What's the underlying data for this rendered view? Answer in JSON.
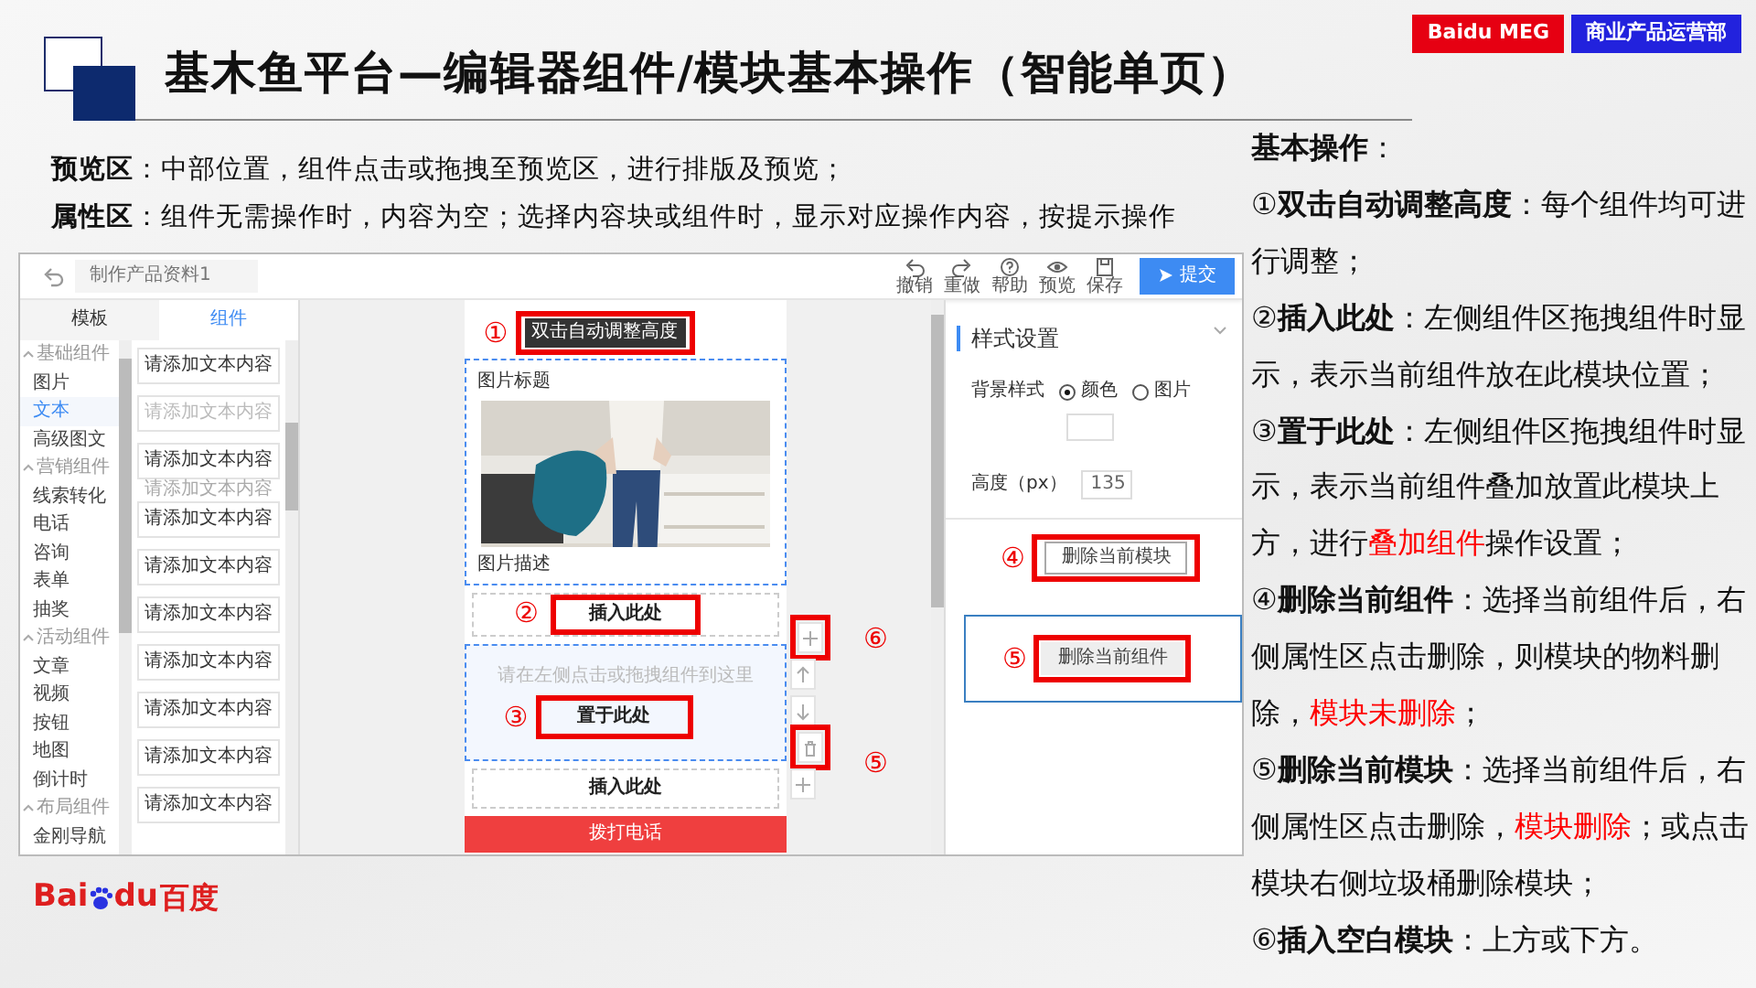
{
  "header": {
    "title": "基木鱼平台—编辑器组件/模块基本操作（智能单页）",
    "badges": [
      {
        "text": "Baidu MEG",
        "color": "#e60012"
      },
      {
        "text": "商业产品运营部",
        "color": "#2222dd"
      }
    ]
  },
  "intro": [
    "**预览区**：中部位置，组件点击或拖拽至预览区，进行排版及预览；",
    "**属性区**：组件无需操作时，内容为空；选择内容块或组件时，显示对应操作内容，按提示操作"
  ],
  "notes": {
    "heading": "**基本操作**：",
    "items": [
      [
        {
          "text": "①**双击自动调整高度**：每个组件均可进行调整；",
          "red": false
        }
      ],
      [
        {
          "text": "②**插入此处**：左侧组件区拖拽组件时显示，表示当前组件放在此模块位置；",
          "red": false
        }
      ],
      [
        {
          "text": "③**置于此处**：左侧组件区拖拽组件时显示，表示当前组件叠加放置此模块上方，进行",
          "red": false
        },
        {
          "text": "叠加组件",
          "red": true
        },
        {
          "text": "操作设置；",
          "red": false
        }
      ],
      [
        {
          "text": "④**删除当前组件**：选择当前组件后，右侧属性区点击删除，则模块的物料删除，",
          "red": false
        },
        {
          "text": "模块未删除",
          "red": true
        },
        {
          "text": "；",
          "red": false
        }
      ],
      [
        {
          "text": "⑤**删除当前模块**：选择当前组件后，右侧属性区点击删除，",
          "red": false
        },
        {
          "text": "模块删除",
          "red": true
        },
        {
          "text": "；或点击模块右侧垃圾桶删除模块；",
          "red": false
        }
      ],
      [
        {
          "text": "⑥**插入空白模块**：上方或下方。",
          "red": false
        }
      ]
    ]
  },
  "editor": {
    "top_bar": {
      "doc_title": "制作产品资料1",
      "tools": [
        "撤销",
        "重做",
        "帮助",
        "预览",
        "保存"
      ],
      "submit": "提交"
    },
    "tabs": [
      {
        "label": "模板",
        "selected": false
      },
      {
        "label": "组件",
        "selected": true
      }
    ],
    "categories": [
      {
        "label": "基础组件",
        "expanded": true,
        "children": [
          {
            "label": "图片",
            "selected": false
          },
          {
            "label": "文本",
            "selected": true
          },
          {
            "label": "高级图文",
            "selected": false
          }
        ]
      },
      {
        "label": "营销组件",
        "expanded": true,
        "children": [
          {
            "label": "线索转化",
            "selected": false
          },
          {
            "label": "电话",
            "selected": false
          },
          {
            "label": "咨询",
            "selected": false
          },
          {
            "label": "表单",
            "selected": false
          },
          {
            "label": "抽奖",
            "selected": false
          }
        ]
      },
      {
        "label": "活动组件",
        "expanded": true,
        "children": [
          {
            "label": "文章",
            "selected": false
          },
          {
            "label": "视频",
            "selected": false
          },
          {
            "label": "按钮",
            "selected": false
          },
          {
            "label": "地图",
            "selected": false
          },
          {
            "label": "倒计时",
            "selected": false
          }
        ]
      },
      {
        "label": "布局组件",
        "expanded": true,
        "children": [
          {
            "label": "金刚导航",
            "selected": false
          }
        ]
      }
    ],
    "components": [
      {
        "text": "请添加文本内容",
        "faded": false
      },
      {
        "text": "请添加文本内容",
        "faded": true
      },
      {
        "text": "请添加文本内容",
        "faded": false
      },
      {
        "text": "请添加文本内容",
        "faded": false
      },
      {
        "text": "请添加文本内容",
        "faded": false
      },
      {
        "text": "请添加文本内容",
        "faded": false
      },
      {
        "text": "请添加文本内容",
        "faded": false
      },
      {
        "text": "请添加文本内容",
        "faded": false
      },
      {
        "text": "请添加文本内容",
        "faded": false
      },
      {
        "text": "请添加文本内容",
        "faded": false
      }
    ],
    "drag_ghost": "请添加文本内容",
    "canvas": {
      "tooltip": {
        "marker": "①",
        "text": "双击自动调整高度"
      },
      "image_block": {
        "title": "图片标题",
        "caption": "图片描述"
      },
      "insert_top": {
        "marker": "②",
        "text": "插入此处"
      },
      "drop_module": {
        "marker": "③",
        "hint": "请在左侧点击或拖拽组件到这里",
        "text": "置于此处"
      },
      "insert_bottom": "插入此处",
      "call_bar": "拨打电话"
    },
    "side_tools": [
      {
        "kind": "plus",
        "marker": "⑥"
      },
      {
        "kind": "up"
      },
      {
        "kind": "down"
      },
      {
        "kind": "trash",
        "marker": "⑤"
      },
      {
        "kind": "plus"
      }
    ],
    "properties": {
      "section": "样式设置",
      "bg_label": "背景样式",
      "options": [
        {
          "label": "颜色",
          "selected": true
        },
        {
          "label": "图片",
          "selected": false
        }
      ],
      "height_label": "高度（px）",
      "height_value": "135",
      "delete_module": {
        "marker": "④",
        "text": "删除当前模块"
      },
      "delete_component": {
        "marker": "⑤",
        "text": "删除当前组件"
      }
    }
  },
  "logo": {
    "parts": [
      "Bai",
      "du",
      "百度"
    ]
  }
}
